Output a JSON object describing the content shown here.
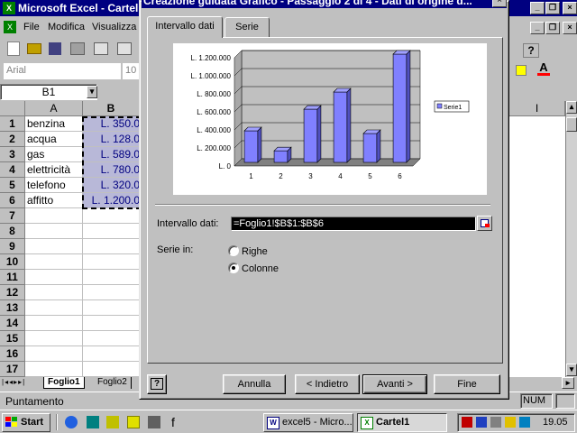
{
  "excel": {
    "title": "Microsoft Excel - Cartel",
    "menu": [
      "File",
      "Modifica",
      "Visualizza"
    ],
    "font_name": "Arial",
    "font_size": "10",
    "name_box": "B1",
    "columns": [
      "A",
      "B"
    ],
    "right_column": "I",
    "rows": [
      "1",
      "2",
      "3",
      "4",
      "5",
      "6",
      "7",
      "8",
      "9",
      "10",
      "11",
      "12",
      "13",
      "14",
      "15",
      "16",
      "17"
    ],
    "col_a": [
      "benzina",
      "acqua",
      "gas",
      "elettricità",
      "telefono",
      "affitto"
    ],
    "col_b": [
      "L. 350.0",
      "L. 128.0",
      "L. 589.0",
      "L. 780.0",
      "L. 320.0",
      "L. 1.200.0"
    ],
    "sheet_tabs": [
      "Foglio1",
      "Foglio2"
    ],
    "status": "Puntamento",
    "num_indicator": "NUM"
  },
  "dialog": {
    "title": "Creazione guidata Grafico - Passaggio 2 di 4 - Dati di origine d...",
    "tabs": [
      "Intervallo dati",
      "Serie"
    ],
    "active_tab": 0,
    "range_label": "Intervallo dati:",
    "range_value": "=Foglio1!$B$1:$B$6",
    "series_in_label": "Serie in:",
    "radio_rows": "Righe",
    "radio_cols": "Colonne",
    "selected_series_in": "Colonne",
    "buttons": {
      "cancel": "Annulla",
      "back": "< Indietro",
      "next": "Avanti >",
      "finish": "Fine"
    },
    "help_icon": "question-mark"
  },
  "chart_data": {
    "type": "bar",
    "categories": [
      "1",
      "2",
      "3",
      "4",
      "5",
      "6"
    ],
    "series": [
      {
        "name": "Serie1",
        "values": [
          350000,
          128000,
          589000,
          780000,
          320000,
          1200000
        ]
      }
    ],
    "ylim": [
      0,
      1200000
    ],
    "yticks": [
      "L. 0",
      "L. 200.000",
      "L. 400.000",
      "L. 600.000",
      "L. 800.000",
      "L. 1.000.000",
      "L. 1.200.000"
    ],
    "bar_color": "#8080ff",
    "legend_position": "right",
    "grid": true
  },
  "taskbar": {
    "start": "Start",
    "tasks": [
      "excel5 - Micro...",
      "Cartel1"
    ],
    "clock": "19.05"
  }
}
